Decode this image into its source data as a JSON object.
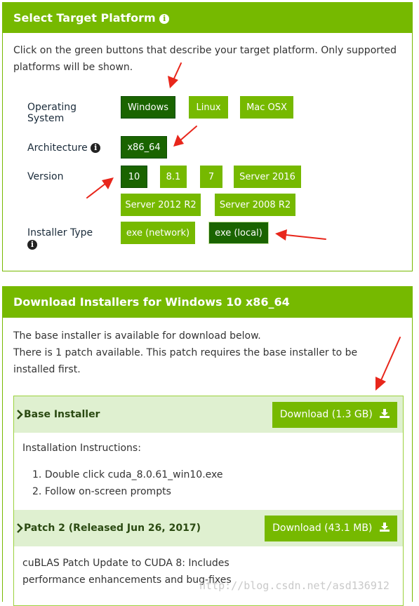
{
  "platform": {
    "header_title": "Select Target Platform",
    "intro_text": "Click on the green buttons that describe your target platform. Only supported platforms will be shown.",
    "rows": {
      "os": {
        "label": "Operating System",
        "options": [
          "Windows",
          "Linux",
          "Mac OSX"
        ],
        "selected": "Windows"
      },
      "arch": {
        "label": "Architecture",
        "options": [
          "x86_64"
        ],
        "selected": "x86_64"
      },
      "version": {
        "label": "Version",
        "options": [
          "10",
          "8.1",
          "7",
          "Server 2016",
          "Server 2012 R2",
          "Server 2008 R2"
        ],
        "selected": "10"
      },
      "installer": {
        "label": "Installer Type",
        "options": [
          "exe (network)",
          "exe (local)"
        ],
        "selected": "exe (local)"
      }
    }
  },
  "download": {
    "header_title": "Download Installers for Windows 10 x86_64",
    "intro_line1": "The base installer is available for download below.",
    "intro_line2": "There is 1 patch available. This patch requires the base installer to be installed first.",
    "base": {
      "title": "Base Installer",
      "button_label": "Download (1.3 GB)",
      "instructions_heading": "Installation Instructions:",
      "steps": [
        "Double click cuda_8.0.61_win10.exe",
        "Follow on-screen prompts"
      ]
    },
    "patch": {
      "title": "Patch 2 (Released Jun 26, 2017)",
      "button_label": "Download (43.1 MB)",
      "description": "cuBLAS Patch Update to CUDA 8: Includes performance enhancements and bug-fixes"
    }
  },
  "watermark": "http://blog.csdn.net/asd136912",
  "colors": {
    "accent": "#76b900",
    "selected": "#1a6400",
    "annotation_arrow": "#e8261b"
  },
  "icons": [
    "info-icon",
    "download-icon",
    "chevron-right-icon",
    "annotation-arrow"
  ]
}
